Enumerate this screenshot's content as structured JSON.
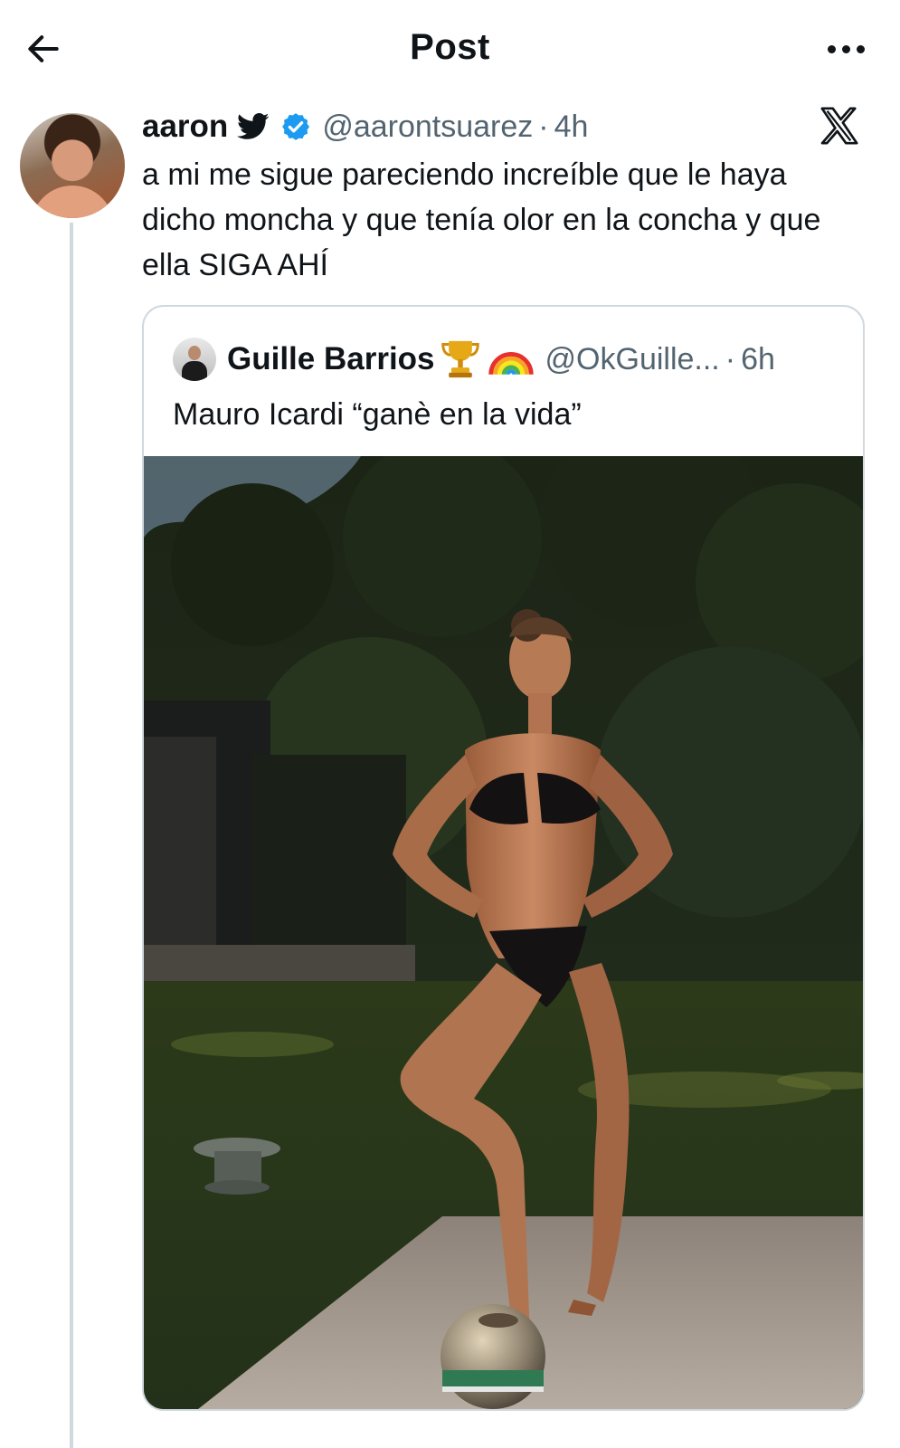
{
  "topbar": {
    "title": "Post",
    "back_icon": "arrow-left-icon",
    "more_icon": "more-horizontal-icon"
  },
  "post": {
    "author_name": "aaron",
    "author_handle": "@aarontsuarez",
    "separator": "·",
    "time": "4h",
    "badges": [
      "bird-icon",
      "verified-icon"
    ],
    "text": "a mi me sigue pareciendo increíble que le haya dicho moncha y que tenía olor en la concha y que ella SIGA AHÍ",
    "platform_icon": "x-logo-icon"
  },
  "quote": {
    "author_name": "Guille Barrios",
    "emojis": [
      "trophy-icon",
      "rainbow-icon"
    ],
    "author_handle": "@OkGuille...",
    "separator": "·",
    "time": "6h",
    "text": "Mauro Icardi “ganè en la vida”",
    "media": "photo"
  },
  "colors": {
    "text_primary": "#0f1419",
    "text_secondary": "#536471",
    "verified_blue": "#1d9bf0",
    "border": "#cfd9de"
  }
}
